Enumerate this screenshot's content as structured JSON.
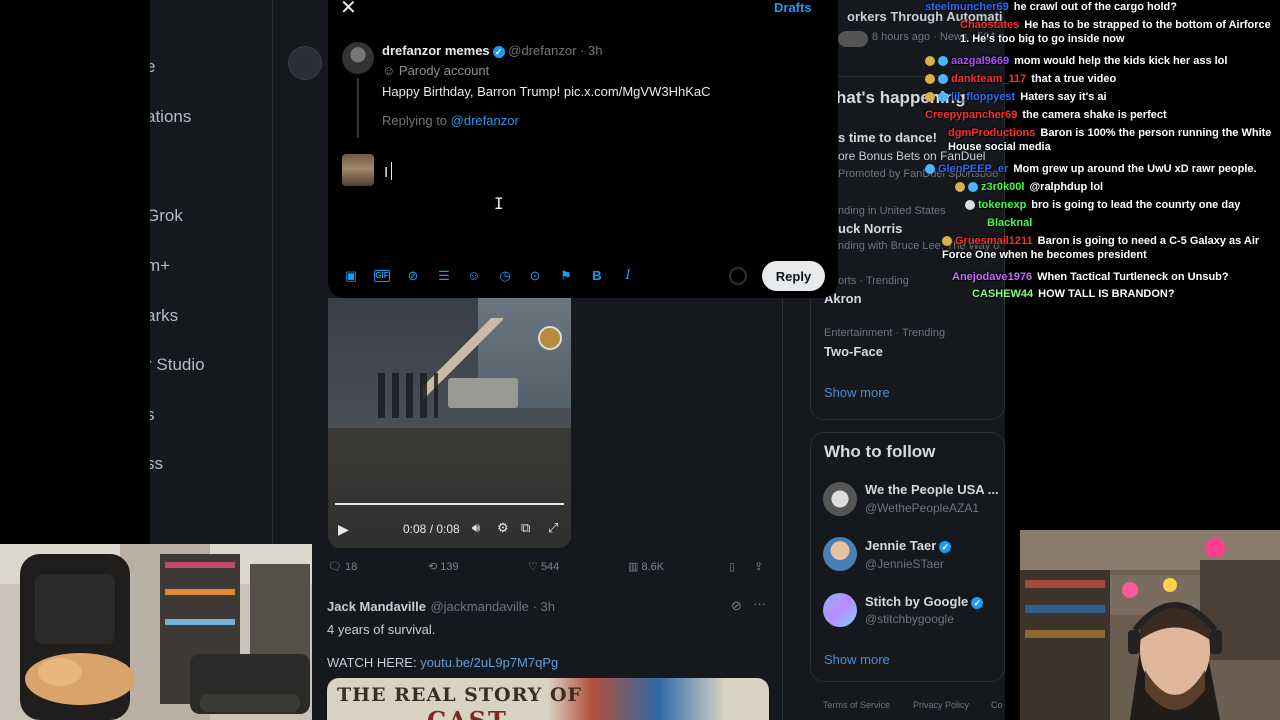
{
  "left_nav": {
    "items": [
      "e",
      "ations",
      "Grok",
      "m+",
      "arks",
      "r Studio",
      "s",
      "ss"
    ]
  },
  "modal": {
    "close_label": "✕",
    "drafts_label": "Drafts",
    "original": {
      "name": "drefanzor memes",
      "handle": "@drefanzor",
      "time": "· 3h",
      "parody_label": "Parody account",
      "text": "Happy Birthday, Barron Trump! pic.x.com/MgVW3HhKaC"
    },
    "replying_prefix": "Replying to",
    "replying_handle": "@drefanzor",
    "compose_value": "I",
    "reply_button": "Reply",
    "toolbar": [
      "image",
      "gif",
      "grok",
      "poll",
      "emoji",
      "schedule",
      "location",
      "flag",
      "bold",
      "italic"
    ]
  },
  "video": {
    "time": "0:08 / 0:08"
  },
  "tweet_actions": {
    "replies": "18",
    "retweets": "139",
    "likes": "544",
    "views": "8.6K"
  },
  "tweet2": {
    "name": "Jack Mandaville",
    "handle": "@jackmandaville · 3h",
    "text": "4 years of survival.",
    "watch_label": "WATCH HERE:",
    "link": "youtu.be/2uL9p7M7qPg",
    "thumb_line1": "THE REAL STORY OF",
    "thumb_line2": "CAST"
  },
  "right": {
    "top_partial": "orkers Through Automation",
    "top_meta": "8 hours ago · News · 504 p",
    "happening_title": "hat's happening",
    "trends": [
      {
        "meta": "",
        "title": "s time to dance!",
        "sub": "ore Bonus Bets on FanDuel",
        "promo": "Promoted by FanDuel Sportsboo"
      },
      {
        "meta": "nding in United States",
        "title": "uck Norris",
        "sub": "nding with Bruce Lee, The Way o"
      },
      {
        "meta": "orts · Trending",
        "title": "Akron"
      },
      {
        "meta": "Entertainment · Trending",
        "title": "Two-Face"
      }
    ],
    "show_more": "Show more",
    "who_to_follow": "Who to follow",
    "follow": [
      {
        "name": "We the People USA ...",
        "handle": "@WethePeopleAZA1"
      },
      {
        "name": "Jennie Taer",
        "handle": "@JennieSTaer"
      },
      {
        "name": "Stitch by Google",
        "handle": "@stitchbygoogle"
      }
    ],
    "show_more_2": "Show more",
    "footer": [
      "Terms of Service",
      "Privacy Policy",
      "Co"
    ]
  },
  "chat": [
    {
      "user": "steelmuncher69",
      "color": "#2e6bff",
      "msg": "he crawl out of the cargo hold?"
    },
    {
      "user": "Chaostates",
      "color": "#ff2d2d",
      "msg": "He has to be strapped to the bottom of Airforce 1. He's too big to go inside now"
    },
    {
      "user": "aazgal9669",
      "color": "#b04bff",
      "msg": "mom would help the kids kick her ass lol"
    },
    {
      "user": "dankteam_117",
      "color": "#ff2d2d",
      "msg": "that a true video"
    },
    {
      "user": "lil_floppyest",
      "color": "#2e6bff",
      "msg": "Haters say it's ai"
    },
    {
      "user": "Creepypancher69",
      "color": "#ff2d2d",
      "msg": "the camera shake is perfect"
    },
    {
      "user": "dgmProductions",
      "color": "#ff2d2d",
      "msg": "Baron is 100% the person running the White House social media"
    },
    {
      "user": "GlenPEEP_er",
      "color": "#2e6bff",
      "msg": "Mom grew up around the UwU xD rawr people."
    },
    {
      "user": "z3r0k00l",
      "color": "#3cff3c",
      "msg": "@ralphdup lol"
    },
    {
      "user": "tokenexp",
      "color": "#3cff3c",
      "msg": "bro is going to lead the counrty one day"
    },
    {
      "user": "Blacknal",
      "color": "#3cff3c",
      "msg": ""
    },
    {
      "user": "Gruesmail1211",
      "color": "#ff2d2d",
      "msg": "Baron is going to need a C-5 Galaxy as Air Force One when he becomes president"
    },
    {
      "user": "Anejodave1976",
      "color": "#c46cff",
      "msg": "When Tactical Turtleneck on Unsub?"
    },
    {
      "user": "CASHEW44",
      "color": "#7dff7d",
      "msg": "HOW TALL IS BRANDON?"
    }
  ]
}
